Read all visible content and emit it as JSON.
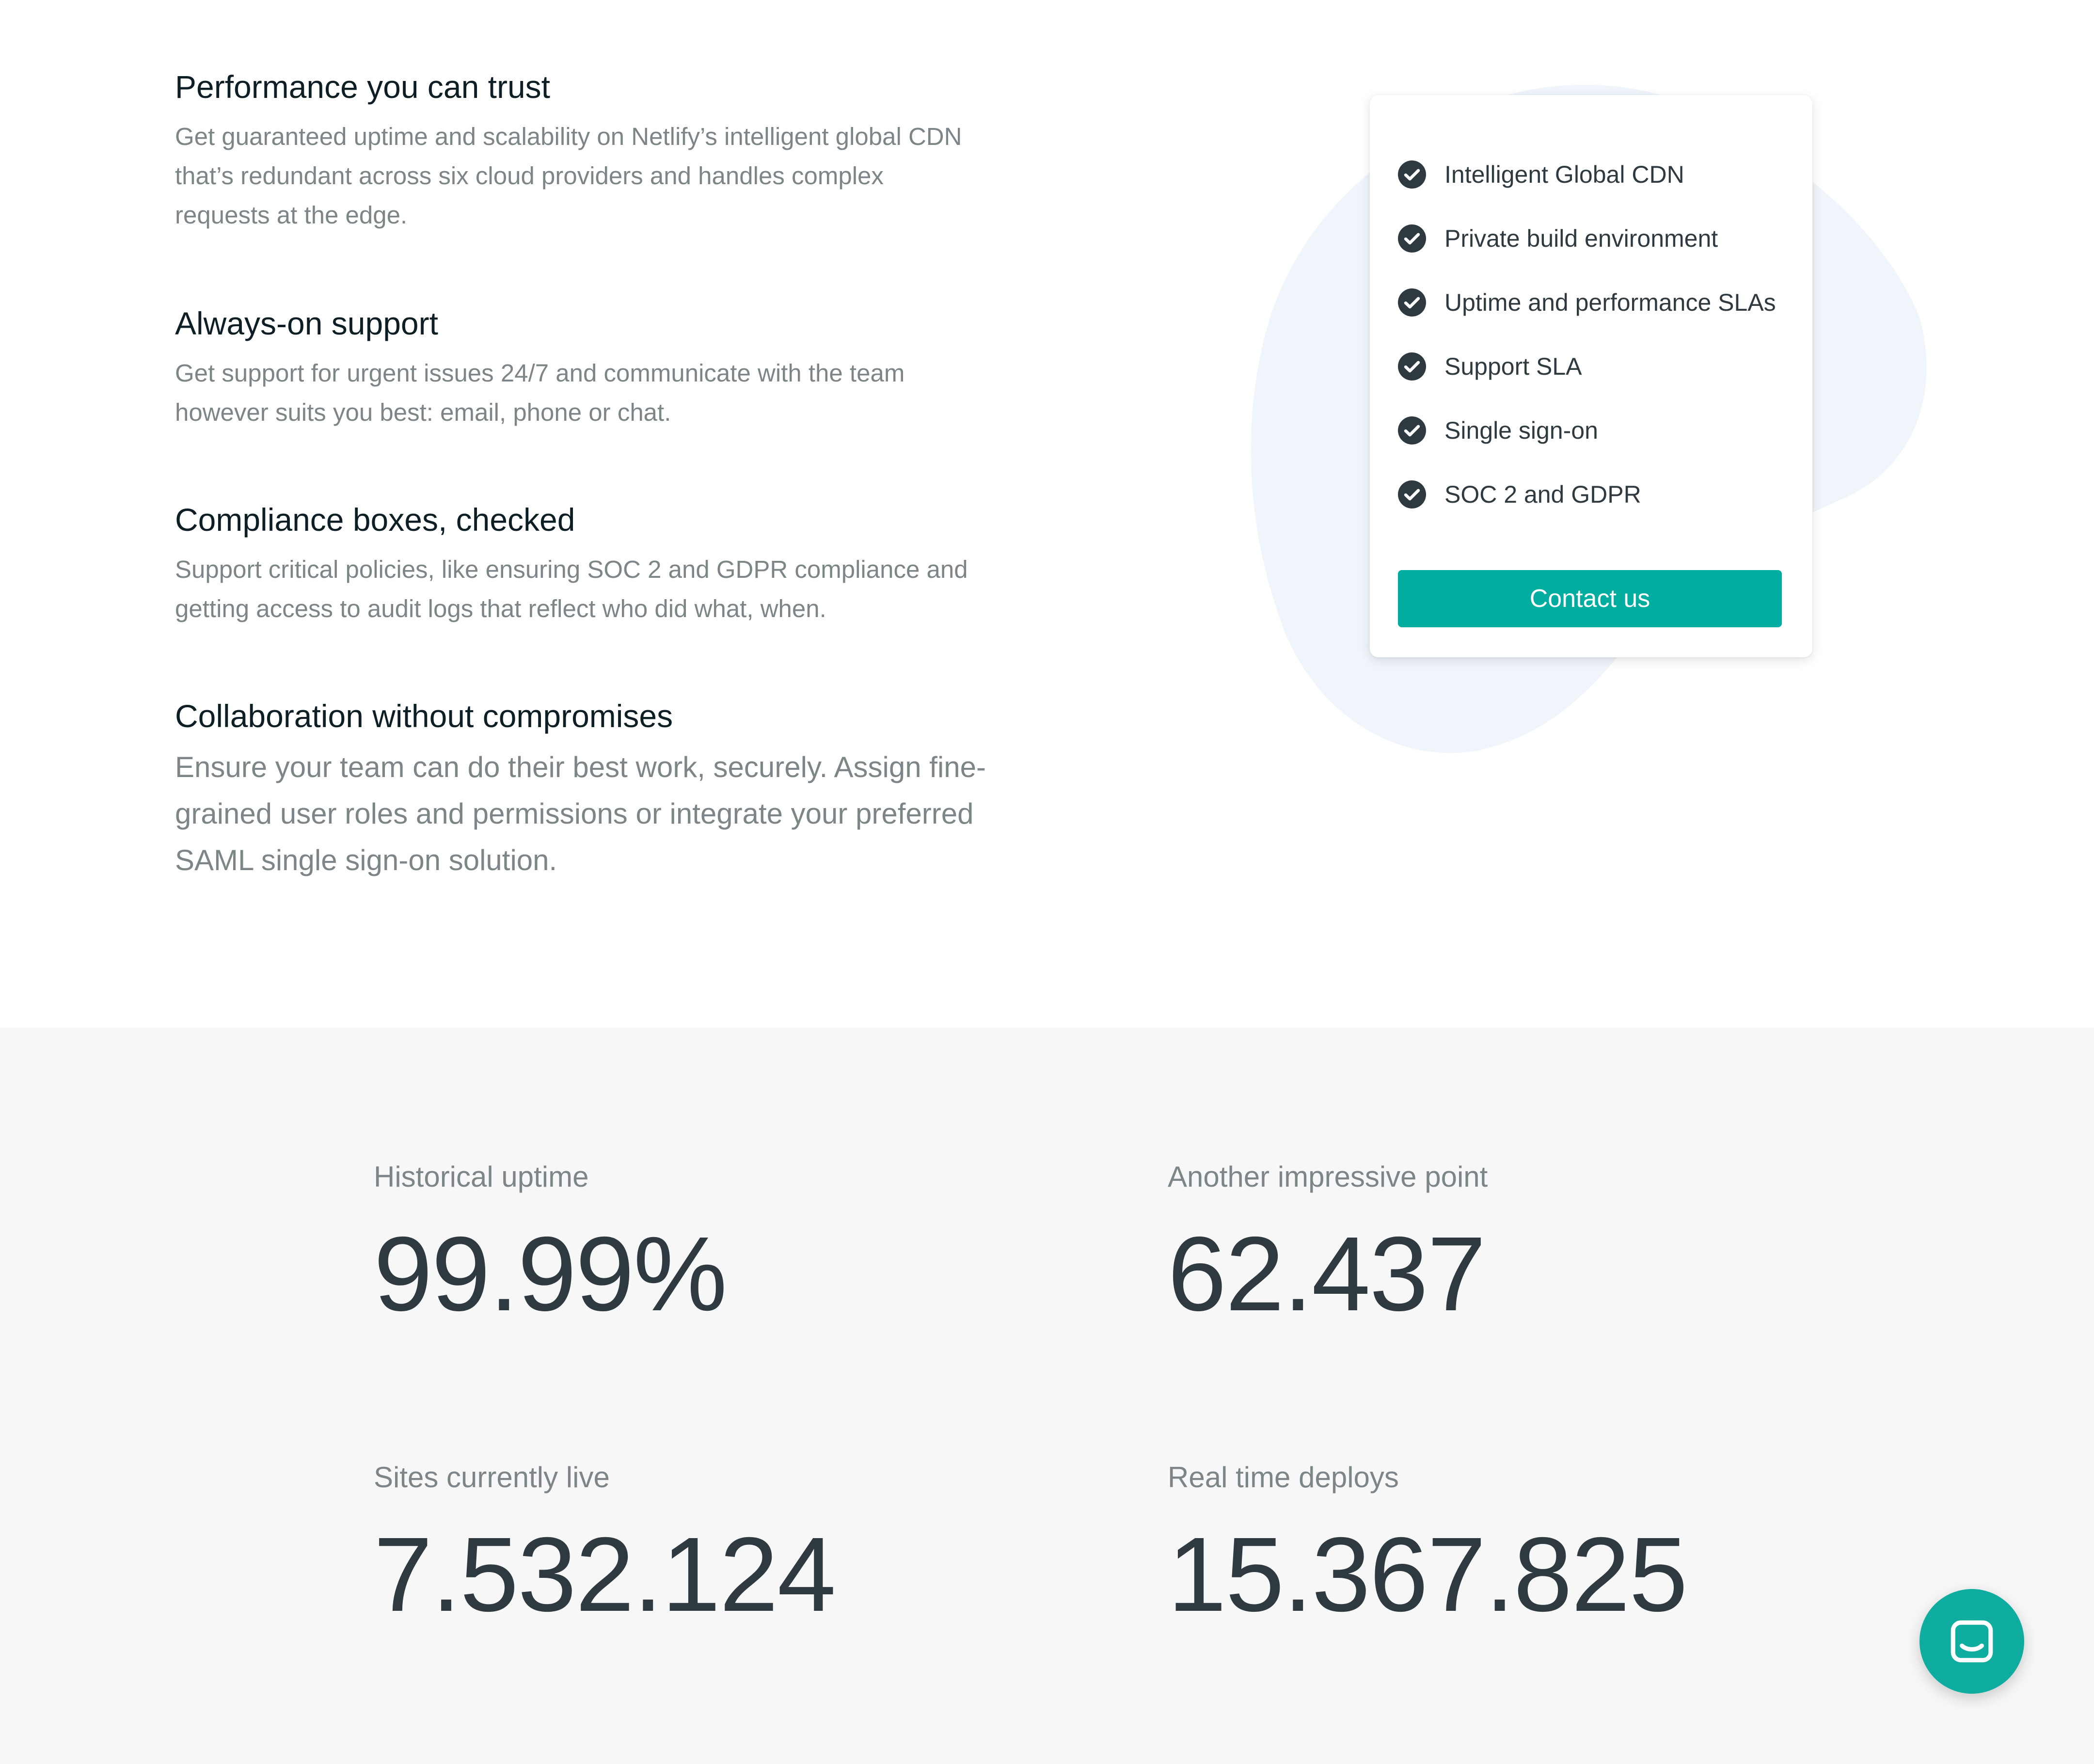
{
  "features": [
    {
      "title": "Performance you can trust",
      "body": "Get guaranteed uptime and scalability on Netlify’s intelligent global CDN that’s redundant across six cloud providers and handles complex requests at the edge."
    },
    {
      "title": "Always-on support",
      "body": "Get support for urgent issues 24/7 and communicate with the team however suits you best: email, phone or chat."
    },
    {
      "title": "Compliance boxes, checked",
      "body": "Support critical policies, like ensuring SOC 2 and GDPR compliance and getting access to audit logs that reflect who did what, when."
    },
    {
      "title": "Collaboration without compromises",
      "body": "Ensure your team can do their best work, securely. Assign fine-grained user roles and permissions or integrate your preferred SAML single sign-on solution."
    }
  ],
  "checklist": [
    "Intelligent Global CDN",
    "Private build environment",
    "Uptime and performance SLAs",
    "Support SLA",
    "Single sign-on",
    "SOC 2 and GDPR"
  ],
  "card": {
    "contact_label": "Contact us"
  },
  "stats": [
    {
      "label": "Historical uptime",
      "value": "99.99%"
    },
    {
      "label": "Another impressive point",
      "value": "62.437"
    },
    {
      "label": "Sites currently live",
      "value": "7.532.124"
    },
    {
      "label": "Real time deploys",
      "value": "15.367.825"
    }
  ],
  "icons": {
    "check": "check-circle-icon",
    "chat": "chat-icon"
  },
  "colors": {
    "accent": "#00ad9f",
    "heading": "#0e1e25",
    "body_text": "#7d8589",
    "stat_value": "#2e3940",
    "stats_bg": "#f7f7f7",
    "blob": "#f0f4fb"
  }
}
